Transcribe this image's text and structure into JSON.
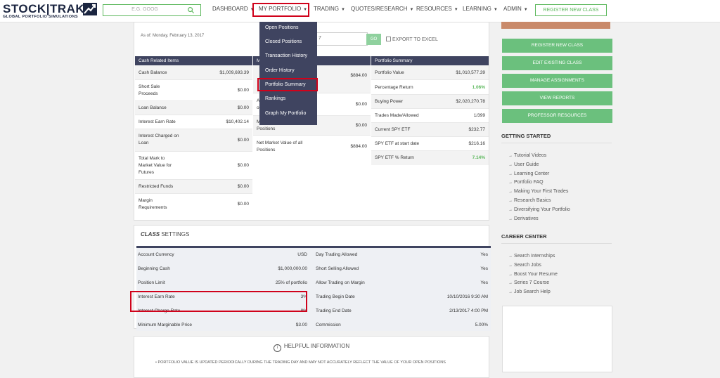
{
  "header": {
    "logo_main": "STOCK|TRAK",
    "logo_sub": "GLOBAL PORTFOLIO SIMULATIONS",
    "search_placeholder": "E.G. GOOG",
    "nav": [
      {
        "label": "DASHBOARD"
      },
      {
        "label": "MY PORTFOLIO"
      },
      {
        "label": "TRADING"
      },
      {
        "label": "QUOTES/RESEARCH"
      },
      {
        "label": "RESOURCES"
      },
      {
        "label": "LEARNING"
      },
      {
        "label": "ADMIN"
      }
    ],
    "register_button": "REGISTER NEW CLASS"
  },
  "portfolio_menu": {
    "items": [
      "Open Positions",
      "Closed Positions",
      "Transaction History",
      "Order History",
      "Portfolio Summary",
      "Rankings",
      "Graph My Portfolio"
    ],
    "highlighted": "Portfolio Summary"
  },
  "summary": {
    "as_of": "As of: Monday, February 13, 2017",
    "date_fragment": "7",
    "go_label": "GO",
    "export_label": "EXPORT TO EXCEL",
    "cash": {
      "heading": "Cash Related Items",
      "rows": [
        {
          "label": "Cash Balance",
          "value": "$1,009,693.39"
        },
        {
          "label": "Short Sale Proceeds",
          "value": "$0.00"
        },
        {
          "label": "Loan Balance",
          "value": "$0.00"
        },
        {
          "label": "Interest Earn Rate",
          "value": "$10,402.14"
        },
        {
          "label": "Interest Charged on Loan",
          "value": "$0.00"
        },
        {
          "label": "Total Mark to Market Value for Futures",
          "value": "$0.00"
        },
        {
          "label": "Restricted Funds",
          "value": "$0.00"
        },
        {
          "label": "Margin Requirements",
          "value": "$0.00"
        }
      ]
    },
    "market": {
      "heading": "M",
      "rows": [
        {
          "label": "",
          "value": "$884.00"
        },
        {
          "label": "A\no",
          "value": "$0.00"
        },
        {
          "label": "M\nPositions",
          "value": "$0.00"
        },
        {
          "label": "Net Market Value of all Positions",
          "value": "$884.00"
        }
      ]
    },
    "portfolio": {
      "heading": "Portfolio Summary",
      "rows": [
        {
          "label": "Portfolio Value",
          "value": "$1,010,577.39"
        },
        {
          "label": "Percentage Return",
          "value": "1.06%"
        },
        {
          "label": "Buying Power",
          "value": "$2,020,270.78"
        },
        {
          "label": "Trades Made/Allowed",
          "value": "1/399"
        },
        {
          "label": "Current SPY ETF",
          "value": "$232.77"
        },
        {
          "label": "SPY ETF at start date",
          "value": "$216.16"
        },
        {
          "label": "SPY ETF % Return",
          "value": "7.14%"
        }
      ]
    }
  },
  "class_settings": {
    "title_bold": "CLASS",
    "title_rest": " SETTINGS",
    "left": [
      {
        "label": "Account Currency",
        "value": "USD"
      },
      {
        "label": "Beginning Cash",
        "value": "$1,000,000.00"
      },
      {
        "label": "Position Limit",
        "value": "25% of portfolio"
      },
      {
        "label": "Interest Earn Rate",
        "value": "3%"
      },
      {
        "label": "Interest Charge Rate",
        "value": "8%"
      },
      {
        "label": "Minimum Marginable Price",
        "value": "$3.00"
      }
    ],
    "right": [
      {
        "label": "Day Trading Allowed",
        "value": "Yes"
      },
      {
        "label": "Short Selling Allowed",
        "value": "Yes"
      },
      {
        "label": "Allow Trading on Margin",
        "value": "Yes"
      },
      {
        "label": "Trading Begin Date",
        "value": "10/10/2016 9:30 AM"
      },
      {
        "label": "Trading End Date",
        "value": "2/13/2017 4:00 PM"
      },
      {
        "label": "Commission",
        "value": "5.00%"
      }
    ]
  },
  "helpful": {
    "title": "HELPFUL INFORMATION",
    "text": "PORTFOLIO VALUE IS UPDATED PERIODICALLY DURING THE TRADING DAY AND MAY NOT ACCURATELY REFLECT THE VALUE OF YOUR OPEN POSITIONS"
  },
  "sidebar": {
    "buttons": [
      "REGISTER NEW CLASS",
      "EDIT EXISTING CLASS",
      "MANAGE ASSIGNMENTS",
      "VIEW REPORTS",
      "PROFESSOR RESOURCES"
    ],
    "getting_started_title": "GETTING STARTED",
    "getting_started": [
      "Tutorial Videos",
      "User Guide",
      "Learning Center",
      "Portfolio FAQ",
      "Making Your First Trades",
      "Research Basics",
      "Diversifying Your Portfolio",
      "Derivatives"
    ],
    "career_title": "CAREER CENTER",
    "career": [
      "Search Internships",
      "Search Jobs",
      "Boost Your Resume",
      "Series 7 Course",
      "Job Search Help"
    ]
  },
  "colors": {
    "accent_green": "#5cb85c",
    "header_navy": "#3f4460",
    "highlight_red": "#d0021b"
  }
}
